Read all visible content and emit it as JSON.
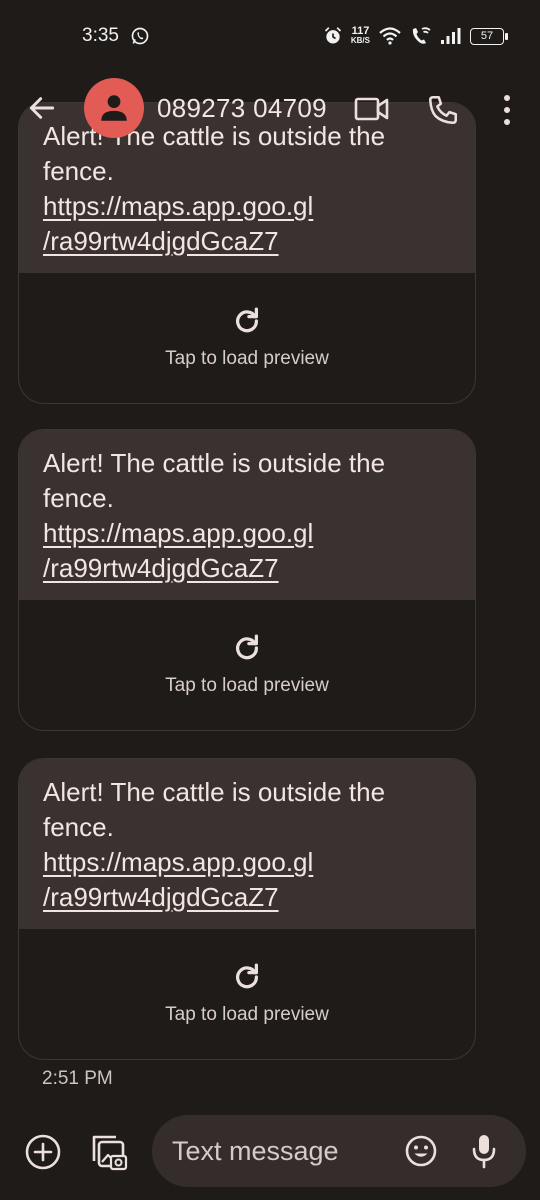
{
  "status_bar": {
    "time": "3:35",
    "net_speed_value": "117",
    "net_speed_unit": "KB/S",
    "battery": "57",
    "icons": [
      "whatsapp-icon",
      "alarm-icon",
      "wifi-icon",
      "wifi-calling-icon",
      "signal-icon",
      "battery-icon"
    ]
  },
  "header": {
    "contact": "089273 04709",
    "icons": [
      "back-arrow-icon",
      "avatar-icon",
      "video-call-icon",
      "phone-icon",
      "more-vert-icon"
    ]
  },
  "messages": [
    {
      "text": "Alert! The cattle is outside the fence.",
      "link_line1": "https://maps.app.goo.gl",
      "link_line2": "/ra99rtw4djgdGcaZ7",
      "preview_label": "Tap to load preview"
    },
    {
      "text": "Alert! The cattle is outside the fence.",
      "link_line1": "https://maps.app.goo.gl",
      "link_line2": "/ra99rtw4djgdGcaZ7",
      "preview_label": "Tap to load preview"
    },
    {
      "text": "Alert! The cattle is outside the fence.",
      "link_line1": "https://maps.app.goo.gl",
      "link_line2": "/ra99rtw4djgdGcaZ7",
      "preview_label": "Tap to load preview"
    }
  ],
  "timestamp": "2:51 PM",
  "compose": {
    "placeholder": "Text message",
    "icons": [
      "add-icon",
      "gallery-icon",
      "emoji-icon",
      "mic-icon"
    ]
  },
  "colors": {
    "background": "#1f1b19",
    "bubble": "#3a3230",
    "avatar": "#e25b55",
    "compose_field": "#352d2b"
  }
}
